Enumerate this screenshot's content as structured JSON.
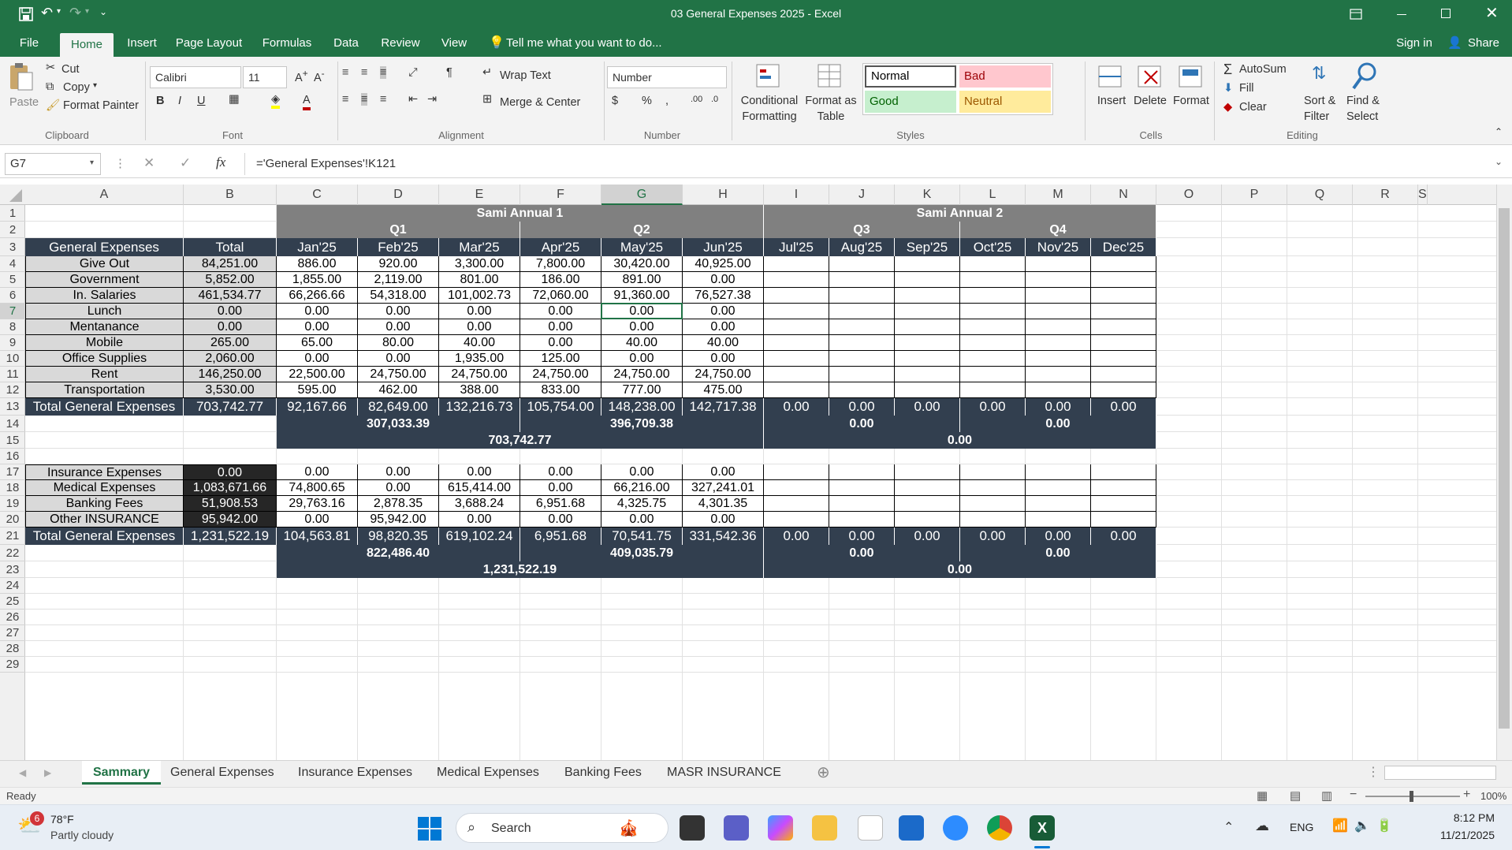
{
  "window": {
    "title": "03 General Expenses 2025 - Excel"
  },
  "ribbon_tabs": [
    "File",
    "Home",
    "Insert",
    "Page Layout",
    "Formulas",
    "Data",
    "Review",
    "View"
  ],
  "tell_me": "Tell me what you want to do...",
  "sign_in": "Sign in",
  "share": "Share",
  "clipboard": {
    "paste": "Paste",
    "cut": "Cut",
    "copy": "Copy",
    "format_painter": "Format Painter",
    "label": "Clipboard"
  },
  "font": {
    "name": "Calibri",
    "size": "11",
    "label": "Font"
  },
  "alignment": {
    "wrap": "Wrap Text",
    "merge": "Merge & Center",
    "label": "Alignment"
  },
  "number": {
    "format": "Number",
    "label": "Number"
  },
  "styles": {
    "cond1": "Conditional",
    "cond2": "Formatting",
    "fat1": "Format as",
    "fat2": "Table",
    "normal": "Normal",
    "bad": "Bad",
    "good": "Good",
    "neutral": "Neutral",
    "label": "Styles"
  },
  "cells": {
    "insert": "Insert",
    "delete": "Delete",
    "format": "Format",
    "label": "Cells"
  },
  "editing": {
    "autosum": "AutoSum",
    "fill": "Fill",
    "clear": "Clear",
    "sort1": "Sort &",
    "sort2": "Filter",
    "find1": "Find &",
    "find2": "Select",
    "label": "Editing"
  },
  "formula_bar": {
    "name_box": "G7",
    "fx": "fx",
    "formula": "='General Expenses'!K121"
  },
  "columns": [
    "A",
    "B",
    "C",
    "D",
    "E",
    "F",
    "G",
    "H",
    "I",
    "J",
    "K",
    "L",
    "M",
    "N",
    "O",
    "P",
    "Q",
    "R",
    "S"
  ],
  "rows": [
    "1",
    "2",
    "3",
    "4",
    "5",
    "6",
    "7",
    "8",
    "9",
    "10",
    "11",
    "12",
    "13",
    "14",
    "15",
    "16",
    "17",
    "18",
    "19",
    "20",
    "21",
    "22",
    "23",
    "24",
    "25",
    "26",
    "27",
    "28",
    "29"
  ],
  "sheet": {
    "annual1": "Sami Annual 1",
    "annual2": "Sami Annual 2",
    "q1": "Q1",
    "q2": "Q2",
    "q3": "Q3",
    "q4": "Q4",
    "header": [
      "General Expenses",
      "Total",
      "Jan'25",
      "Feb'25",
      "Mar'25",
      "Apr'25",
      "May'25",
      "Jun'25",
      "Jul'25",
      "Aug'25",
      "Sep'25",
      "Oct'25",
      "Nov'25",
      "Dec'25"
    ],
    "block1": [
      [
        "Give Out",
        "84,251.00",
        "886.00",
        "920.00",
        "3,300.00",
        "7,800.00",
        "30,420.00",
        "40,925.00"
      ],
      [
        "Government",
        "5,852.00",
        "1,855.00",
        "2,119.00",
        "801.00",
        "186.00",
        "891.00",
        "0.00"
      ],
      [
        "In. Salaries",
        "461,534.77",
        "66,266.66",
        "54,318.00",
        "101,002.73",
        "72,060.00",
        "91,360.00",
        "76,527.38"
      ],
      [
        "Lunch",
        "0.00",
        "0.00",
        "0.00",
        "0.00",
        "0.00",
        "0.00",
        "0.00"
      ],
      [
        "Mentanance",
        "0.00",
        "0.00",
        "0.00",
        "0.00",
        "0.00",
        "0.00",
        "0.00"
      ],
      [
        "Mobile",
        "265.00",
        "65.00",
        "80.00",
        "40.00",
        "0.00",
        "40.00",
        "40.00"
      ],
      [
        "Office Supplies",
        "2,060.00",
        "0.00",
        "0.00",
        "1,935.00",
        "125.00",
        "0.00",
        "0.00"
      ],
      [
        "Rent",
        "146,250.00",
        "22,500.00",
        "24,750.00",
        "24,750.00",
        "24,750.00",
        "24,750.00",
        "24,750.00"
      ],
      [
        "Transportation",
        "3,530.00",
        "595.00",
        "462.00",
        "388.00",
        "833.00",
        "777.00",
        "475.00"
      ]
    ],
    "total1": [
      "Total General Expenses",
      "703,742.77",
      "92,167.66",
      "82,649.00",
      "132,216.73",
      "105,754.00",
      "148,238.00",
      "142,717.38",
      "0.00",
      "0.00",
      "0.00",
      "0.00",
      "0.00",
      "0.00"
    ],
    "quarter1": [
      "307,033.39",
      "396,709.38",
      "0.00",
      "0.00"
    ],
    "half1": [
      "703,742.77",
      "0.00"
    ],
    "block2": [
      [
        "Insurance Expenses",
        "0.00",
        "0.00",
        "0.00",
        "0.00",
        "0.00",
        "0.00",
        "0.00"
      ],
      [
        "Medical Expenses",
        "1,083,671.66",
        "74,800.65",
        "0.00",
        "615,414.00",
        "0.00",
        "66,216.00",
        "327,241.01"
      ],
      [
        "Banking Fees",
        "51,908.53",
        "29,763.16",
        "2,878.35",
        "3,688.24",
        "6,951.68",
        "4,325.75",
        "4,301.35"
      ],
      [
        "Other INSURANCE",
        "95,942.00",
        "0.00",
        "95,942.00",
        "0.00",
        "0.00",
        "0.00",
        "0.00"
      ]
    ],
    "total2": [
      "Total General Expenses",
      "1,231,522.19",
      "104,563.81",
      "98,820.35",
      "619,102.24",
      "6,951.68",
      "70,541.75",
      "331,542.36",
      "0.00",
      "0.00",
      "0.00",
      "0.00",
      "0.00",
      "0.00"
    ],
    "quarter2": [
      "822,486.40",
      "409,035.79",
      "0.00",
      "0.00"
    ],
    "half2": [
      "1,231,522.19",
      "0.00"
    ]
  },
  "sheet_tabs": [
    "Sammary",
    "General Expenses",
    "Insurance Expenses",
    "Medical Expenses",
    "Banking Fees",
    "MASR INSURANCE"
  ],
  "status": {
    "ready": "Ready",
    "zoom": "100%"
  },
  "taskbar": {
    "temp": "78°F",
    "weather": "Partly cloudy",
    "badge": "6",
    "search": "Search",
    "lang": "ENG",
    "time": "8:12 PM",
    "date": "11/21/2025"
  },
  "colors": {
    "excel_green": "#217346",
    "dark_header": "#323F4F",
    "gray_header": "#808080",
    "total_col": "#D9D9D9",
    "label_col": "#D9D9D9"
  }
}
